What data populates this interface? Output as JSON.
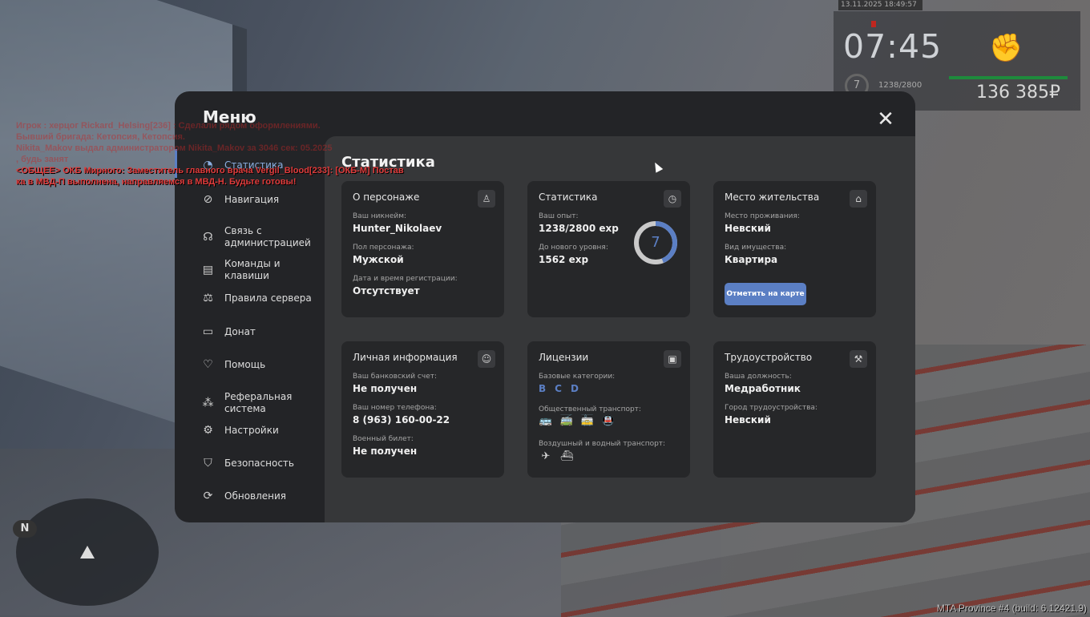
{
  "hud": {
    "datetime": "13.11.2025 18:49:57",
    "time": "07:45",
    "level": "7",
    "exp": "1238/2800",
    "money": "136 385₽"
  },
  "chat": {
    "lines_faded": [
      "Игрок : херцог Rickard_Helsing[236] : Сделали рядом оформлениями.",
      "Бывший бригада: Кетопсия, Кетопсия.",
      "Nikita_Makov выдал администратором Nikita_Makov за 3046 сек: 05.2025",
      ", будь занят"
    ],
    "lines_live": [
      "<ОБЩЕЕ> ОКБ Мирного: Заместитель главного врача Vergil_Blood[233]: [ОКБ-М] Постав",
      "ка в МВД-П выполнена, направляемся в МВД-Н. Будьте готовы!"
    ]
  },
  "minimap": {
    "north": "N"
  },
  "build": "MTA Province #4 (build: 6.12421.9)",
  "menu": {
    "title": "Меню",
    "sidebar": [
      {
        "label": "Статистика",
        "icon": "stats-icon"
      },
      {
        "label": "Навигация",
        "icon": "compass-icon"
      },
      {
        "label": "Связь с администрацией",
        "icon": "headset-icon"
      },
      {
        "label": "Команды и клавиши",
        "icon": "document-icon"
      },
      {
        "label": "Правила сервера",
        "icon": "scales-icon"
      },
      {
        "label": "Донат",
        "icon": "wallet-icon"
      },
      {
        "label": "Помощь",
        "icon": "handshake-icon"
      },
      {
        "label": "Реферальная система",
        "icon": "network-icon"
      },
      {
        "label": "Настройки",
        "icon": "gear-icon"
      },
      {
        "label": "Безопасность",
        "icon": "shield-icon"
      },
      {
        "label": "Обновления",
        "icon": "refresh-icon"
      }
    ],
    "section_title": "Статистика",
    "cards": {
      "character": {
        "title": "О персонаже",
        "nick_label": "Ваш никнейм:",
        "nick": "Hunter_Nikolaev",
        "gender_label": "Пол персонажа:",
        "gender": "Мужской",
        "reg_label": "Дата и время регистрации:",
        "reg": "Отсутствует"
      },
      "stats": {
        "title": "Статистика",
        "exp_label": "Ваш опыт:",
        "exp": "1238/2800 exp",
        "next_label": "До нового уровня:",
        "next": "1562 exp",
        "level": "7",
        "progress": 0.44,
        "ring_color": "#5b7fc4"
      },
      "residence": {
        "title": "Место жительства",
        "place_label": "Место проживания:",
        "place": "Невский",
        "type_label": "Вид имущества:",
        "type": "Квартира",
        "button": "Отметить на карте"
      },
      "personal": {
        "title": "Личная информация",
        "bank_label": "Ваш банковский счет:",
        "bank": "Не получен",
        "phone_label": "Ваш номер телефона:",
        "phone": "8 (963) 160-00-22",
        "military_label": "Военный билет:",
        "military": "Не получен"
      },
      "licenses": {
        "title": "Лицензии",
        "base_label": "Базовые категории:",
        "categories": [
          "B",
          "C",
          "D"
        ],
        "public_label": "Общественный транспорт:",
        "air_label": "Воздушный и водный транспорт:"
      },
      "employment": {
        "title": "Трудоустройство",
        "position_label": "Ваша должность:",
        "position": "Медработник",
        "city_label": "Город трудоустройства:",
        "city": "Невский"
      }
    }
  }
}
